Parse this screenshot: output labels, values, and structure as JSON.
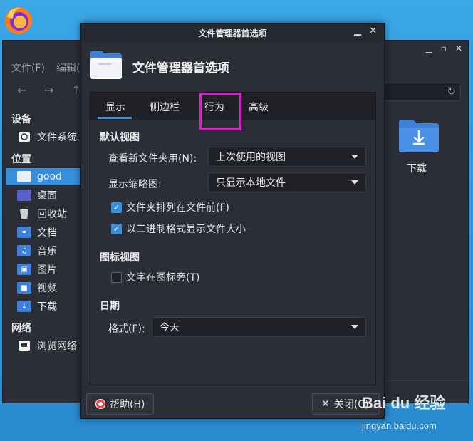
{
  "file_manager": {
    "menu": [
      "文件(F)",
      "编辑("
    ],
    "sidebar": {
      "devices_heading": "设备",
      "devices": [
        {
          "label": "文件系统",
          "icon": "drive-icon"
        }
      ],
      "places_heading": "位置",
      "places": [
        {
          "label": "good",
          "icon": "home-folder-icon",
          "selected": true
        },
        {
          "label": "桌面",
          "icon": "desktop-icon"
        },
        {
          "label": "回收站",
          "icon": "trash-icon"
        },
        {
          "label": "文档",
          "icon": "documents-folder-icon"
        },
        {
          "label": "音乐",
          "icon": "music-folder-icon"
        },
        {
          "label": "图片",
          "icon": "pictures-folder-icon"
        },
        {
          "label": "视频",
          "icon": "videos-folder-icon"
        },
        {
          "label": "下载",
          "icon": "downloads-folder-icon"
        }
      ],
      "network_heading": "网络",
      "network": [
        {
          "label": "浏览网络",
          "icon": "network-icon"
        }
      ]
    },
    "content_items": [
      {
        "label": "下载",
        "icon": "downloads-folder-icon"
      }
    ]
  },
  "dialog": {
    "window_title": "文件管理器首选项",
    "heading": "文件管理器首选项",
    "tabs": [
      {
        "label": "显示",
        "active": true
      },
      {
        "label": "侧边栏",
        "active": false
      },
      {
        "label": "行为",
        "active": false
      },
      {
        "label": "高级",
        "active": false
      }
    ],
    "default_view": {
      "title": "默认视图",
      "new_folder_label": "查看新文件夹用(N):",
      "new_folder_value": "上次使用的视图",
      "thumbnails_label": "显示缩略图:",
      "thumbnails_value": "只显示本地文件",
      "folders_first": {
        "label": "文件夹排列在文件前(F)",
        "checked": true
      },
      "binary_sizes": {
        "label": "以二进制格式显示文件大小",
        "checked": true
      }
    },
    "icon_view": {
      "title": "图标视图",
      "text_beside": {
        "label": "文字在图标旁(T)",
        "checked": false
      }
    },
    "date": {
      "title": "日期",
      "format_label": "格式(F):",
      "format_value": "今天"
    },
    "help_button": "帮助(H)",
    "close_button": "关闭(C)"
  },
  "watermark": {
    "brand": "Bai du 经验",
    "url": "jingyan.baidu.com"
  },
  "colors": {
    "accent": "#3a8fdb",
    "highlight_box": "#e61ad4",
    "window_bg": "#2b2e37",
    "desktop_bg": "#2f96dc"
  }
}
